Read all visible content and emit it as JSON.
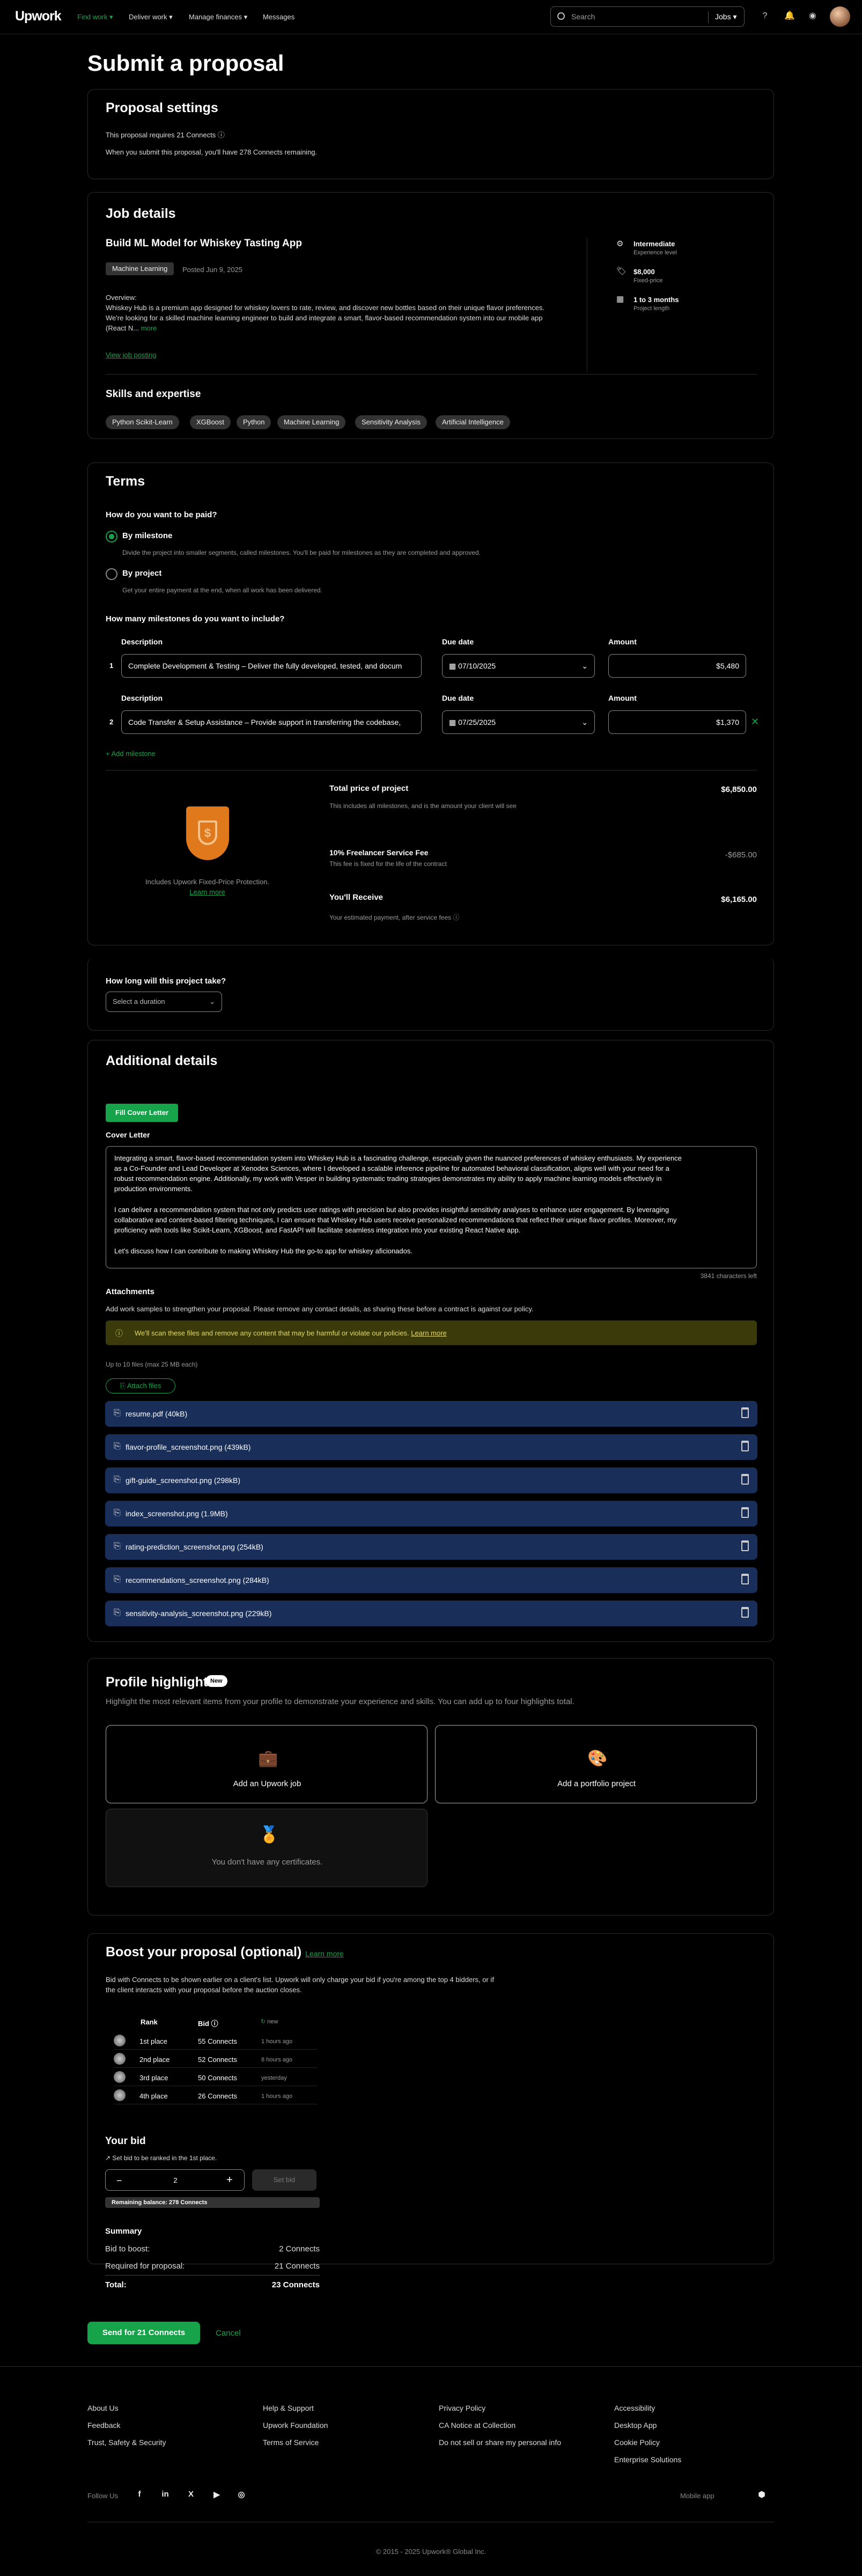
{
  "nav": {
    "logo": "Upwork",
    "find_work": "Find work",
    "deliver_work": "Deliver work",
    "manage_finances": "Manage finances",
    "messages": "Messages",
    "search_placeholder": "Search",
    "search_scope": "Jobs"
  },
  "page_title": "Submit a proposal",
  "settings": {
    "heading": "Proposal settings",
    "requires": "This proposal requires 21 Connects",
    "remaining": "When you submit this proposal, you'll have 278 Connects remaining."
  },
  "job": {
    "heading": "Job details",
    "title": "Build ML Model for Whiskey Tasting App",
    "category": "Machine Learning",
    "posted": "Posted Jun 9, 2025",
    "overview_label": "Overview:",
    "desc1": "Whiskey Hub is a premium app designed for whiskey lovers to rate, review, and discover new bottles based on their unique flavor preferences.",
    "desc2": "We're looking for a skilled machine learning engineer to build and integrate a smart, flavor-based recommendation system into our mobile app",
    "desc3": "(React N...",
    "more": "more",
    "view_posting": "View job posting",
    "level": "Intermediate",
    "level_sub": "Experience level",
    "price": "$8,000",
    "price_sub": "Fixed-price",
    "length": "1 to 3 months",
    "length_sub": "Project length",
    "skills_heading": "Skills and expertise",
    "skills": [
      "Python Scikit-Learn",
      "XGBoost",
      "Python",
      "Machine Learning",
      "Sensitivity Analysis",
      "Artificial Intelligence"
    ]
  },
  "terms": {
    "heading": "Terms",
    "paid_q": "How do you want to be paid?",
    "by_milestone": "By milestone",
    "milestone_desc": "Divide the project into smaller segments, called milestones. You'll be paid for milestones as they are completed and approved.",
    "by_project": "By project",
    "project_desc": "Get your entire payment at the end, when all work has been delivered.",
    "how_many": "How many milestones do you want to include?",
    "desc_label": "Description",
    "due_label": "Due date",
    "amount_label": "Amount",
    "milestones": [
      {
        "num": "1",
        "desc": "Complete Development & Testing – Deliver the fully developed, tested, and docum",
        "due": "07/10/2025",
        "amount": "$5,480"
      },
      {
        "num": "2",
        "desc": "Code Transfer & Setup Assistance – Provide support in transferring the codebase,",
        "due": "07/25/2025",
        "amount": "$1,370"
      }
    ],
    "add_milestone": "+ Add milestone",
    "protection": "Includes Upwork Fixed-Price Protection.",
    "learn_more": "Learn more",
    "total_label": "Total price of project",
    "total_value": "$6,850.00",
    "total_desc": "This includes all milestones, and is the amount your client will see",
    "fee_label": "10% Freelancer Service Fee",
    "fee_value": "-$685.00",
    "fee_desc": "This fee is fixed for the life of the contract",
    "receive_label": "You'll Receive",
    "receive_value": "$6,165.00",
    "receive_desc": "Your estimated payment, after service fees"
  },
  "duration": {
    "question": "How long will this project take?",
    "placeholder": "Select a duration"
  },
  "additional": {
    "heading": "Additional details",
    "fill_btn": "Fill Cover Letter",
    "cover_label": "Cover Letter",
    "cover_p1": [
      "Integrating a smart, flavor-based recommendation system into Whiskey Hub is a fascinating challenge, especially given the nuanced preferences of whiskey enthusiasts. My experience",
      "as a Co-Founder and Lead Developer at Xenodex Sciences, where I developed a scalable inference pipeline for automated behavioral classification, aligns well with your need for a",
      "robust recommendation engine. Additionally, my work with Vesper in building systematic trading strategies demonstrates my ability to apply machine learning models effectively in",
      "production environments."
    ],
    "cover_p2": [
      "I can deliver a recommendation system that not only predicts user ratings with precision but also provides insightful sensitivity analyses to enhance user engagement. By leveraging",
      "collaborative and content-based filtering techniques, I can ensure that Whiskey Hub users receive personalized recommendations that reflect their unique flavor profiles. Moreover, my",
      "proficiency with tools like Scikit-Learn, XGBoost, and FastAPI will facilitate seamless integration into your existing React Native app."
    ],
    "cover_p3": "Let's discuss how I can contribute to making Whiskey Hub the go-to app for whiskey aficionados.",
    "chars_left": "3841 characters left",
    "attach_heading": "Attachments",
    "attach_desc": "Add work samples to strengthen your proposal. Please remove any contact details, as sharing these before a contract is against our policy.",
    "warn": "We'll scan these files and remove any content that may be harmful or violate our policies.",
    "warn_link": "Learn more",
    "limit": "Up to 10 files (max 25 MB each)",
    "attach_btn": "Attach files",
    "files": [
      "resume.pdf  (40kB)",
      "flavor-profile_screenshot.png  (439kB)",
      "gift-guide_screenshot.png  (298kB)",
      "index_screenshot.png  (1.9MB)",
      "rating-prediction_screenshot.png  (254kB)",
      "recommendations_screenshot.png  (284kB)",
      "sensitivity-analysis_screenshot.png  (229kB)"
    ]
  },
  "highlights": {
    "heading": "Profile highlights",
    "badge": "New",
    "desc": "Highlight the most relevant items from your profile to demonstrate your experience and skills. You can add up to four highlights total.",
    "add_job": "Add an Upwork job",
    "add_portfolio": "Add a portfolio project",
    "no_certs": "You don't have any certificates."
  },
  "boost": {
    "heading": "Boost your proposal (optional)",
    "learn_more": "Learn more",
    "desc1": "Bid with Connects to be shown earlier on a client's list. Upwork will only charge your bid if you're among the top 4 bidders, or if",
    "desc2": "the client interacts with your proposal before the auction closes.",
    "col_rank": "Rank",
    "col_bid": "Bid",
    "col_new": "new",
    "rows": [
      {
        "rank": "1st place",
        "bid": "55 Connects",
        "time": "1 hours ago"
      },
      {
        "rank": "2nd place",
        "bid": "52 Connects",
        "time": "8 hours ago"
      },
      {
        "rank": "3rd place",
        "bid": "50 Connects",
        "time": "yesterday"
      },
      {
        "rank": "4th place",
        "bid": "26 Connects",
        "time": "1 hours ago"
      }
    ],
    "your_bid": "Your bid",
    "bid_hint": "Set bid to be ranked in the 1st place.",
    "bid_value": "2",
    "set_bid": "Set bid",
    "balance": "Remaining balance: 278 Connects",
    "summary": "Summary",
    "bid_label": "Bid to boost:",
    "bid_val": "2 Connects",
    "req_label": "Required for proposal:",
    "req_val": "21 Connects",
    "total_label": "Total:",
    "total_val": "23 Connects"
  },
  "actions": {
    "send": "Send for 21 Connects",
    "cancel": "Cancel"
  },
  "footer": {
    "col1": [
      "About Us",
      "Feedback",
      "Trust, Safety & Security"
    ],
    "col2": [
      "Help & Support",
      "Upwork Foundation",
      "Terms of Service"
    ],
    "col3": [
      "Privacy Policy",
      "CA Notice at Collection",
      "Do not sell or share my personal info"
    ],
    "col4": [
      "Accessibility",
      "Desktop App",
      "Cookie Policy",
      "Enterprise Solutions"
    ],
    "follow": "Follow Us",
    "mobile": "Mobile app",
    "copyright": "© 2015 - 2025 Upwork® Global Inc."
  },
  "colors": {
    "accent": "#16a34a",
    "file_bg": "#1a2e5a"
  }
}
